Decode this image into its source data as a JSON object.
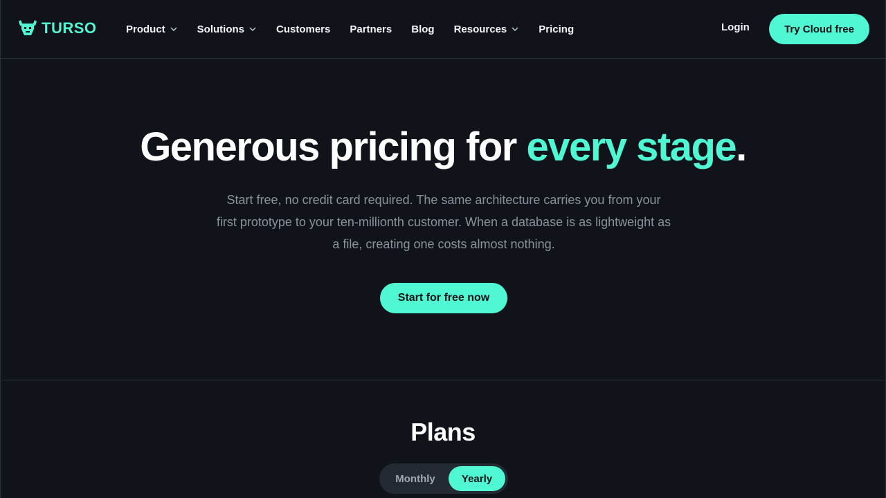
{
  "brand": {
    "name": "TURSO",
    "logo_icon": "bull-icon",
    "accent": "#4ff8d2"
  },
  "nav": {
    "items": [
      {
        "label": "Product",
        "has_dropdown": true
      },
      {
        "label": "Solutions",
        "has_dropdown": true
      },
      {
        "label": "Customers",
        "has_dropdown": false
      },
      {
        "label": "Partners",
        "has_dropdown": false
      },
      {
        "label": "Blog",
        "has_dropdown": false
      },
      {
        "label": "Resources",
        "has_dropdown": true
      },
      {
        "label": "Pricing",
        "has_dropdown": false
      }
    ],
    "login_label": "Login",
    "cta_label": "Try Cloud free"
  },
  "hero": {
    "title_main": "Generous pricing for ",
    "title_accent": "every stage",
    "title_end": ".",
    "subtitle": "Start free, no credit card required. The same architecture carries you from your first prototype to your ten-millionth customer. When a database is as lightweight as a file, creating one costs almost nothing.",
    "cta_label": "Start for free now"
  },
  "plans": {
    "title": "Plans",
    "billing_options": [
      "Monthly",
      "Yearly"
    ],
    "selected_billing": "Yearly"
  }
}
